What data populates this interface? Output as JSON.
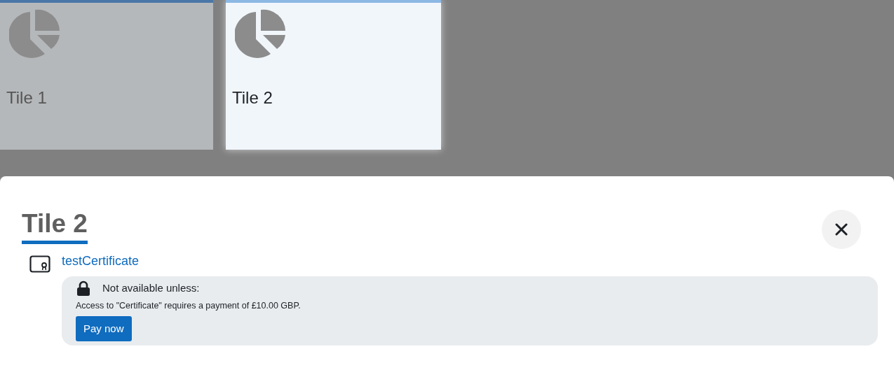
{
  "tiles": [
    {
      "label": "Tile 1",
      "selected": false
    },
    {
      "label": "Tile 2",
      "selected": true
    }
  ],
  "sheet": {
    "title": "Tile 2",
    "activity": {
      "name": "testCertificate",
      "restriction": {
        "heading": "Not available unless:",
        "message": "Access to \"Certificate\" requires a payment of £10.00 GBP.",
        "button": "Pay now"
      }
    }
  }
}
